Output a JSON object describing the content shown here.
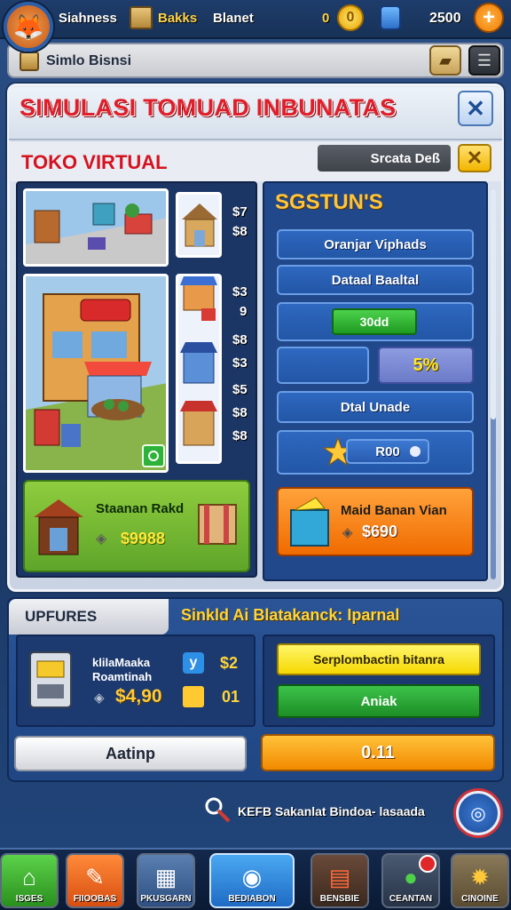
{
  "hud": {
    "player_label": "Siahness",
    "boxes_label": "Bakks",
    "planet_label": "Blanet",
    "coins_value": "0",
    "coin_symbol": "0",
    "gems_value": "2500",
    "plus_symbol": "+"
  },
  "subbar": {
    "label": "Simlo Bisnsi"
  },
  "panel": {
    "title": "SIMULASI TOMUAD INBUNATAS",
    "close_symbol": "✕",
    "subtitle": "TOKO VIRTUAL",
    "status_pill": "Srcata Deß",
    "status_close": "✕"
  },
  "shop": {
    "prices": [
      "$7",
      "$8",
      "$3",
      "9",
      "$8",
      "$3",
      "$5",
      "$8",
      "$8"
    ],
    "card_title": "Staanan Rakd",
    "card_price": "$9988"
  },
  "stats": {
    "title": "SGSTUN'S",
    "rows": [
      "Oranjar Viphads",
      "Dataal Baaltal"
    ],
    "green_button": "30dd",
    "percent": "5%",
    "upgrade_label": "Dtal Unade",
    "slider_value": "R00",
    "cta_title": "Maid Banan Vian",
    "cta_price": "$690"
  },
  "lower": {
    "tab_label": "UPFURES",
    "heading": "Sinkld Ai Blatakanck: Iparnal",
    "item_title": "klilaMaaka Roamtinah",
    "item_price": "$4,90",
    "badge_a": "$2",
    "badge_b": "01",
    "yellow_button": "Serplombactin bitanra",
    "green_button": "Aniak",
    "grey_button": "Aatinp",
    "orange_button": "0.11"
  },
  "footer": {
    "note": "KEFB Sakanlat  Bindoa- lasaada"
  },
  "nav": {
    "items": [
      "ISGES",
      "FIIOOBAS",
      "PKUSGARN",
      "BEDIABON",
      "BENSBIE",
      "CEANTAN",
      "CINOINE"
    ]
  },
  "colors": {
    "title_red": "#e01e2a",
    "accent_orange": "#f06b00",
    "accent_yellow": "#ffc53a",
    "panel_blue": "#21488a"
  }
}
